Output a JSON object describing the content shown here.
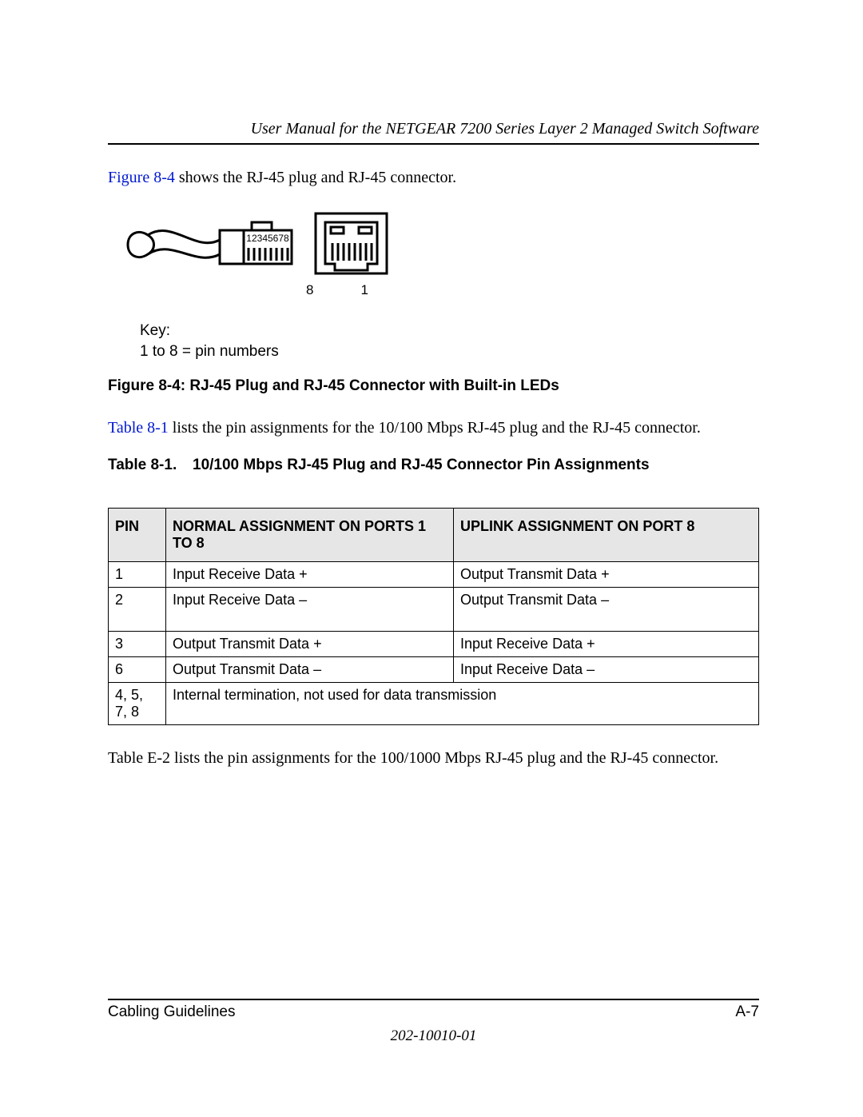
{
  "header": {
    "running_title": "User Manual for the NETGEAR 7200 Series Layer 2 Managed Switch Software"
  },
  "intro": {
    "fig_ref": "Figure 8-4",
    "fig_ref_rest": " shows the RJ-45 plug and RJ-45 connector."
  },
  "figure": {
    "plug_pins_label": "12345678",
    "jack_left_label": "8",
    "jack_right_label": "1",
    "key_line1": "Key:",
    "key_line2": "1 to 8 = pin numbers",
    "caption": "Figure 8-4:  RJ-45 Plug and RJ-45 Connector with Built-in LEDs"
  },
  "table_intro": {
    "ref": "Table 8-1",
    "rest": " lists the pin assignments for the 10/100 Mbps RJ-45 plug and the RJ-45 connector."
  },
  "table": {
    "label": "Table 8-1.",
    "title": "10/100 Mbps RJ-45 Plug and RJ-45 Connector Pin Assignments",
    "columns": {
      "pin": "PIN",
      "normal": "NORMAL ASSIGNMENT ON PORTS 1 TO 8",
      "uplink": "UPLINK ASSIGNMENT ON PORT 8"
    },
    "rows": [
      {
        "pin": "1",
        "normal": "Input Receive Data +",
        "uplink": "Output Transmit Data +"
      },
      {
        "pin": "2",
        "normal": "Input Receive Data –",
        "uplink": "Output Transmit Data –"
      },
      {
        "pin": "3",
        "normal": "Output Transmit Data +",
        "uplink": "Input Receive Data +"
      },
      {
        "pin": "6",
        "normal": "Output Transmit Data –",
        "uplink": "Input Receive Data –"
      }
    ],
    "span_row": {
      "pin": "4, 5, 7, 8",
      "text": "Internal termination, not used for data transmission"
    }
  },
  "after_table": "Table E-2 lists the pin assignments for the 100/1000 Mbps RJ-45 plug and the RJ-45 connector.",
  "footer": {
    "section": "Cabling Guidelines",
    "page_no": "A-7",
    "doc_no": "202-10010-01"
  }
}
